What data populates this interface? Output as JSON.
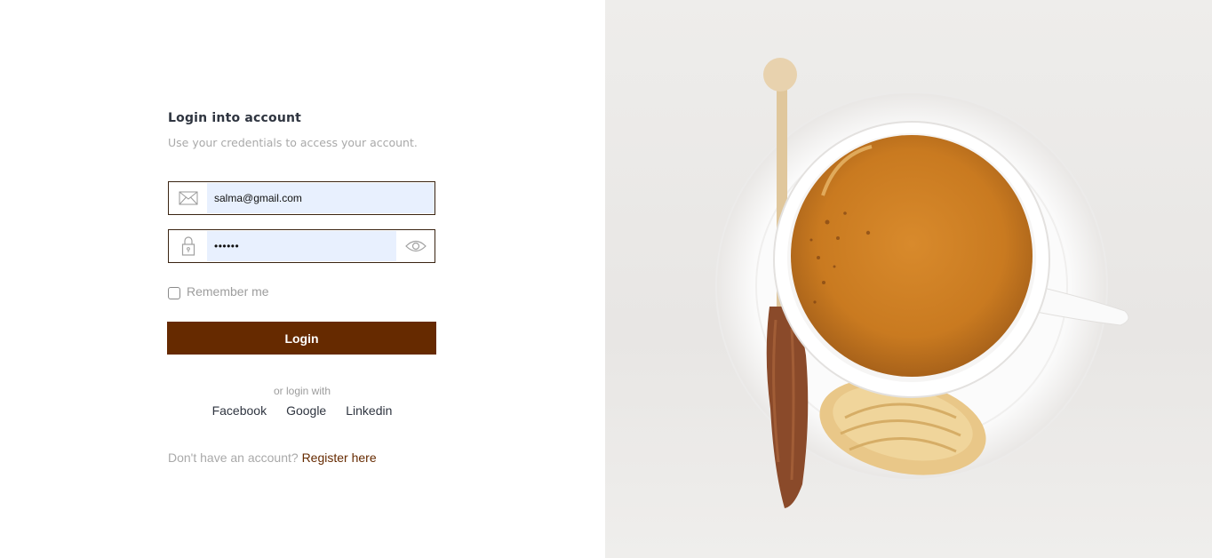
{
  "login": {
    "title": "Login into account",
    "subtitle": "Use your credentials to access your account.",
    "email": {
      "value": "salma@gmail.com",
      "icon": "envelope-icon"
    },
    "password": {
      "value": "••••••",
      "icon": "lock-icon",
      "toggle_icon": "eye-icon"
    },
    "remember_label": "Remember me",
    "remember_checked": false,
    "submit_label": "Login",
    "or_login_with": "or login with",
    "socials": [
      "Facebook",
      "Google",
      "Linkedin"
    ],
    "register_prompt": "Don't have an account?",
    "register_link": "Register here"
  },
  "colors": {
    "accent": "#662a00",
    "input_autofill": "#e8f0fe",
    "border": "#3a2412",
    "muted_text": "#a9a9a9",
    "title_text": "#2f3540"
  },
  "hero_image": {
    "subject": "coffee-cup-with-rock-candy-stick-and-madeleine"
  }
}
